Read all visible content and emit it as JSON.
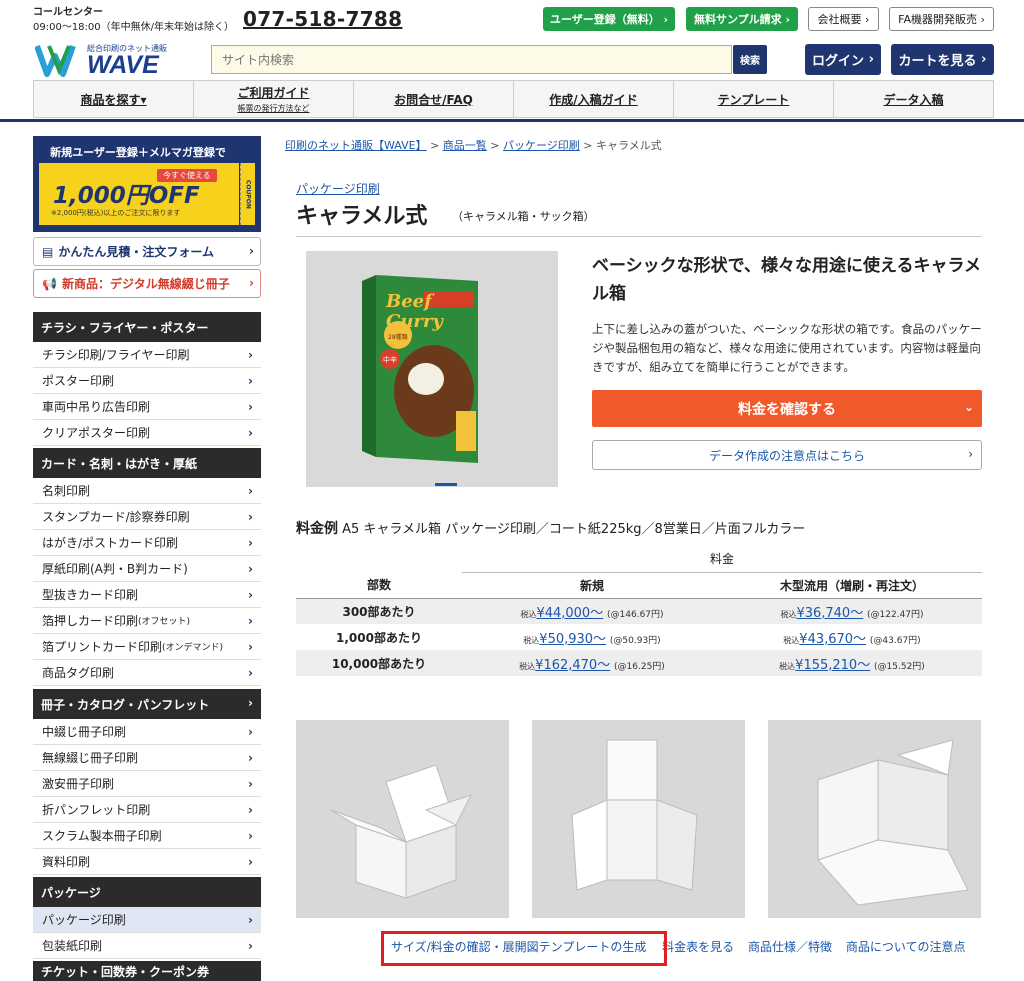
{
  "topbar": {
    "call_label": "コールセンター",
    "call_hours": "09:00〜18:00（年中無休/年末年始は除く）",
    "phone": "077-518-7788",
    "buttons": [
      "ユーザー登録（無料）",
      "無料サンプル請求",
      "会社概要",
      "FA機器開発販売"
    ]
  },
  "header": {
    "logo_tag": "総合印刷のネット通販",
    "logo_name": "WAVE",
    "search_placeholder": "サイト内検索",
    "search_button": "検索",
    "login": "ログイン",
    "cart": "カートを見る"
  },
  "nav": [
    {
      "label": "商品を探す▾",
      "sub": ""
    },
    {
      "label": "ご利用ガイド",
      "sub": "帳票の発行方法など"
    },
    {
      "label": "お問合せ/FAQ",
      "sub": ""
    },
    {
      "label": "作成/入稿ガイド",
      "sub": ""
    },
    {
      "label": "テンプレート",
      "sub": ""
    },
    {
      "label": "データ入稿",
      "sub": ""
    }
  ],
  "sidebar": {
    "coupon": {
      "headline": "新規ユーザー登録＋メルマガ登録で",
      "tag": "今すぐ使える",
      "amount": "1,000円OFF",
      "note": "※2,000円(税込)以上のご注文に限ります",
      "side": "COUPON"
    },
    "estimate_link": "かんたん見積・注文フォーム",
    "new_link": "新商品：デジタル無線綴じ冊子",
    "cat1": "チラシ・フライヤー・ポスター",
    "cat1_items": [
      "チラシ印刷/フライヤー印刷",
      "ポスター印刷",
      "車両中吊り広告印刷",
      "クリアポスター印刷"
    ],
    "cat2": "カード・名刺・はがき・厚紙",
    "cat2_items": [
      "名刺印刷",
      "スタンプカード/診察券印刷",
      "はがき/ポストカード印刷",
      "厚紙印刷(A判・B判カード)",
      "型抜きカード印刷"
    ],
    "cat2_item6": "箔押しカード印刷",
    "cat2_item6_sub": "(オフセット)",
    "cat2_item7": "箔プリントカード印刷",
    "cat2_item7_sub": "(オンデマンド)",
    "cat2_item8": "商品タグ印刷",
    "cat3": "冊子・カタログ・パンフレット",
    "cat3_items": [
      "中綴じ冊子印刷",
      "無線綴じ冊子印刷",
      "激安冊子印刷",
      "折パンフレット印刷",
      "スクラム製本冊子印刷",
      "資料印刷"
    ],
    "cat4": "パッケージ",
    "cat4_items": [
      "パッケージ印刷",
      "包装紙印刷"
    ],
    "cat5": "チケット・回数券・クーポン券"
  },
  "breadcrumb": [
    "印刷のネット通販【WAVE】",
    "商品一覧",
    "パッケージ印刷",
    "キャラメル式"
  ],
  "product": {
    "category": "パッケージ印刷",
    "title": "キャラメル式",
    "subtitle": "（キャラメル箱・サック箱）",
    "headline": "ベーシックな形状で、様々な用途に使えるキャラメル箱",
    "description": "上下に差し込みの蓋がついた、ベーシックな形状の箱です。食品のパッケージや製品梱包用の箱など、様々な用途に使用されています。内容物は軽量向きですが、組み立てを簡単に行うことができます。",
    "price_button": "料金を確認する",
    "data_button": "データ作成の注意点はこちら",
    "box_label_1": "Beef",
    "box_label_2": "Curry",
    "box_badge": "28種類のスパイス",
    "box_text": "中辛"
  },
  "price_example": {
    "label": "料金例",
    "spec": "A5 キャラメル箱 パッケージ印刷／コート紙225kg／8営業日／片面フルカラー",
    "group_header": "料金",
    "col_qty": "部数",
    "col_new": "新規",
    "col_reuse": "木型流用（増刷・再注文）",
    "tax_label": "税込",
    "rows": [
      {
        "qty": "300部あたり",
        "new": "¥44,000〜",
        "new_unit": "(@146.67円)",
        "reuse": "¥36,740〜",
        "reuse_unit": "(@122.47円)"
      },
      {
        "qty": "1,000部あたり",
        "new": "¥50,930〜",
        "new_unit": "(@50.93円)",
        "reuse": "¥43,670〜",
        "reuse_unit": "(@43.67円)"
      },
      {
        "qty": "10,000部あたり",
        "new": "¥162,470〜",
        "new_unit": "(@16.25円)",
        "reuse": "¥155,210〜",
        "reuse_unit": "(@15.52円)"
      }
    ]
  },
  "bottom_links": [
    "サイズ/料金の確認・展開図テンプレートの生成",
    "料金表を見る",
    "商品仕様／特徴",
    "商品についての注意点"
  ],
  "colors": {
    "accent": "#f0592a",
    "navy": "#1e3570",
    "green": "#21a04a",
    "highlight": "#e02020"
  }
}
